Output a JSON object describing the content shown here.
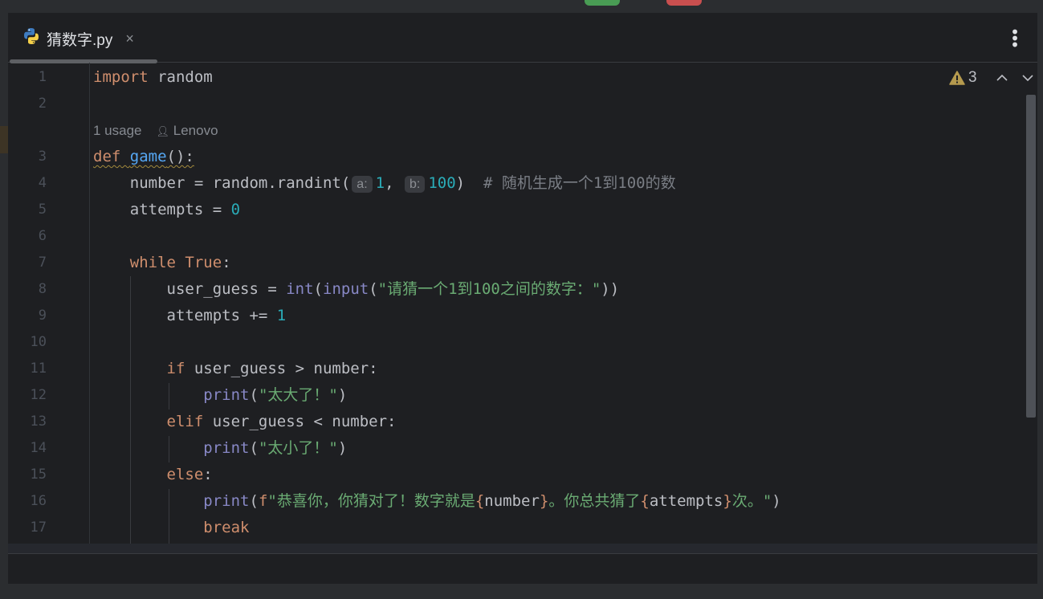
{
  "window": {
    "accent_green": "#499c54",
    "accent_red": "#c94f4f"
  },
  "tab": {
    "title": "猜数字.py",
    "icon": "python-icon",
    "close": "×"
  },
  "inspections": {
    "warning_count": "3",
    "up": "⌃",
    "down": "⌄"
  },
  "codelens": {
    "usages": "1 usage",
    "author": "Lenovo"
  },
  "lines": [
    {
      "n": "1",
      "tokens": [
        [
          "kw",
          "import"
        ],
        [
          "tx",
          " random"
        ]
      ]
    },
    {
      "n": "2",
      "tokens": []
    },
    {
      "n": "3",
      "tokens": [
        [
          "kw squig",
          "def"
        ],
        [
          "tx squig",
          " "
        ],
        [
          "fn squig",
          "game"
        ],
        [
          "tx squig",
          "():"
        ]
      ]
    },
    {
      "n": "4",
      "tokens": [
        [
          "tx",
          "    number = random.randint("
        ],
        [
          "hint",
          "a:"
        ],
        [
          "num",
          "1"
        ],
        [
          "tx",
          ", "
        ],
        [
          "hint",
          "b:"
        ],
        [
          "num",
          "100"
        ],
        [
          "tx",
          ")  "
        ],
        [
          "cm",
          "# 随机生成一个1到100的数"
        ]
      ]
    },
    {
      "n": "5",
      "tokens": [
        [
          "tx",
          "    attempts = "
        ],
        [
          "num",
          "0"
        ]
      ]
    },
    {
      "n": "6",
      "tokens": []
    },
    {
      "n": "7",
      "tokens": [
        [
          "tx",
          "    "
        ],
        [
          "kw",
          "while"
        ],
        [
          "tx",
          " "
        ],
        [
          "kw",
          "True"
        ],
        [
          "tx",
          ":"
        ]
      ]
    },
    {
      "n": "8",
      "tokens": [
        [
          "tx",
          "        user_guess = "
        ],
        [
          "bi",
          "int"
        ],
        [
          "tx",
          "("
        ],
        [
          "bi",
          "input"
        ],
        [
          "tx",
          "("
        ],
        [
          "str",
          "\"请猜一个1到100之间的数字：\""
        ],
        [
          "tx",
          "))"
        ]
      ]
    },
    {
      "n": "9",
      "tokens": [
        [
          "tx",
          "        attempts += "
        ],
        [
          "num",
          "1"
        ]
      ]
    },
    {
      "n": "10",
      "tokens": []
    },
    {
      "n": "11",
      "tokens": [
        [
          "tx",
          "        "
        ],
        [
          "kw",
          "if"
        ],
        [
          "tx",
          " user_guess > number:"
        ]
      ]
    },
    {
      "n": "12",
      "tokens": [
        [
          "tx",
          "            "
        ],
        [
          "bi",
          "print"
        ],
        [
          "tx",
          "("
        ],
        [
          "str",
          "\"太大了！\""
        ],
        [
          "tx",
          ")"
        ]
      ]
    },
    {
      "n": "13",
      "tokens": [
        [
          "tx",
          "        "
        ],
        [
          "kw",
          "elif"
        ],
        [
          "tx",
          " user_guess < number:"
        ]
      ]
    },
    {
      "n": "14",
      "tokens": [
        [
          "tx",
          "            "
        ],
        [
          "bi",
          "print"
        ],
        [
          "tx",
          "("
        ],
        [
          "str",
          "\"太小了！\""
        ],
        [
          "tx",
          ")"
        ]
      ]
    },
    {
      "n": "15",
      "tokens": [
        [
          "tx",
          "        "
        ],
        [
          "kw",
          "else"
        ],
        [
          "tx",
          ":"
        ]
      ]
    },
    {
      "n": "16",
      "tokens": [
        [
          "tx",
          "            "
        ],
        [
          "bi",
          "print"
        ],
        [
          "tx",
          "("
        ],
        [
          "kw",
          "f"
        ],
        [
          "str",
          "\"恭喜你，你猜对了！数字就是"
        ],
        [
          "br",
          "{"
        ],
        [
          "tx",
          "number"
        ],
        [
          "br",
          "}"
        ],
        [
          "str",
          "。你总共猜了"
        ],
        [
          "br",
          "{"
        ],
        [
          "tx",
          "attempts"
        ],
        [
          "br",
          "}"
        ],
        [
          "str",
          "次。\""
        ],
        [
          "tx",
          ")"
        ]
      ]
    },
    {
      "n": "17",
      "tokens": [
        [
          "tx",
          "            "
        ],
        [
          "kw",
          "break"
        ]
      ]
    }
  ]
}
